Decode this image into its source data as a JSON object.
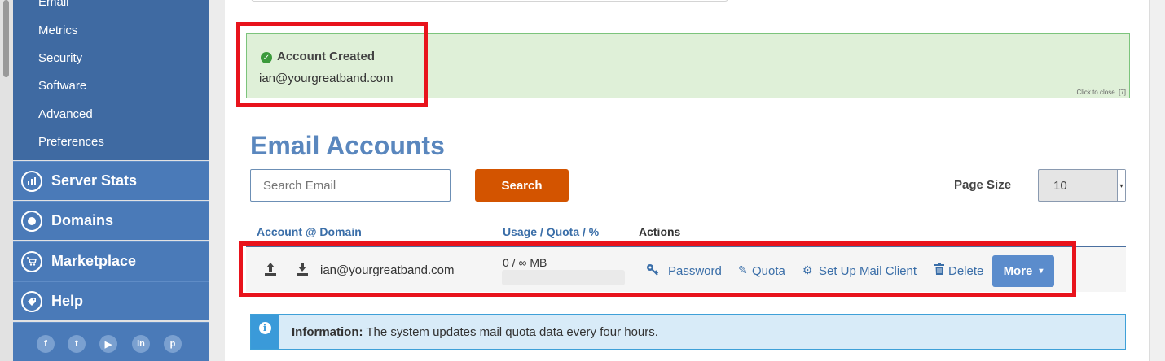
{
  "sidebar": {
    "sub_items": [
      "Email",
      "Metrics",
      "Security",
      "Software",
      "Advanced",
      "Preferences"
    ],
    "main_items": [
      "Server Stats",
      "Domains",
      "Marketplace",
      "Help"
    ],
    "social": [
      "f",
      "t",
      "yt",
      "in",
      "p"
    ]
  },
  "alert": {
    "title": "Account Created",
    "email": "ian@yourgreatband.com",
    "close_text": "Click to close. [7]"
  },
  "page": {
    "title": "Email Accounts"
  },
  "search": {
    "placeholder": "Search Email",
    "button": "Search"
  },
  "page_size": {
    "label": "Page Size",
    "value": "10"
  },
  "table": {
    "columns": [
      "Account @ Domain",
      "Usage / Quota / %",
      "Actions"
    ],
    "rows": [
      {
        "email": "ian@yourgreatband.com",
        "usage": "0 / ∞ MB",
        "actions": [
          "Password",
          "Quota",
          "Set Up Mail Client",
          "Delete"
        ],
        "more": "More"
      }
    ]
  },
  "info": {
    "label": "Information:",
    "text": " The system updates mail quota data every four hours."
  },
  "colors": {
    "accent": "#5a87be",
    "search_button": "#d35400",
    "highlight_border": "#e8131c",
    "success_bg": "#dff0d8"
  }
}
